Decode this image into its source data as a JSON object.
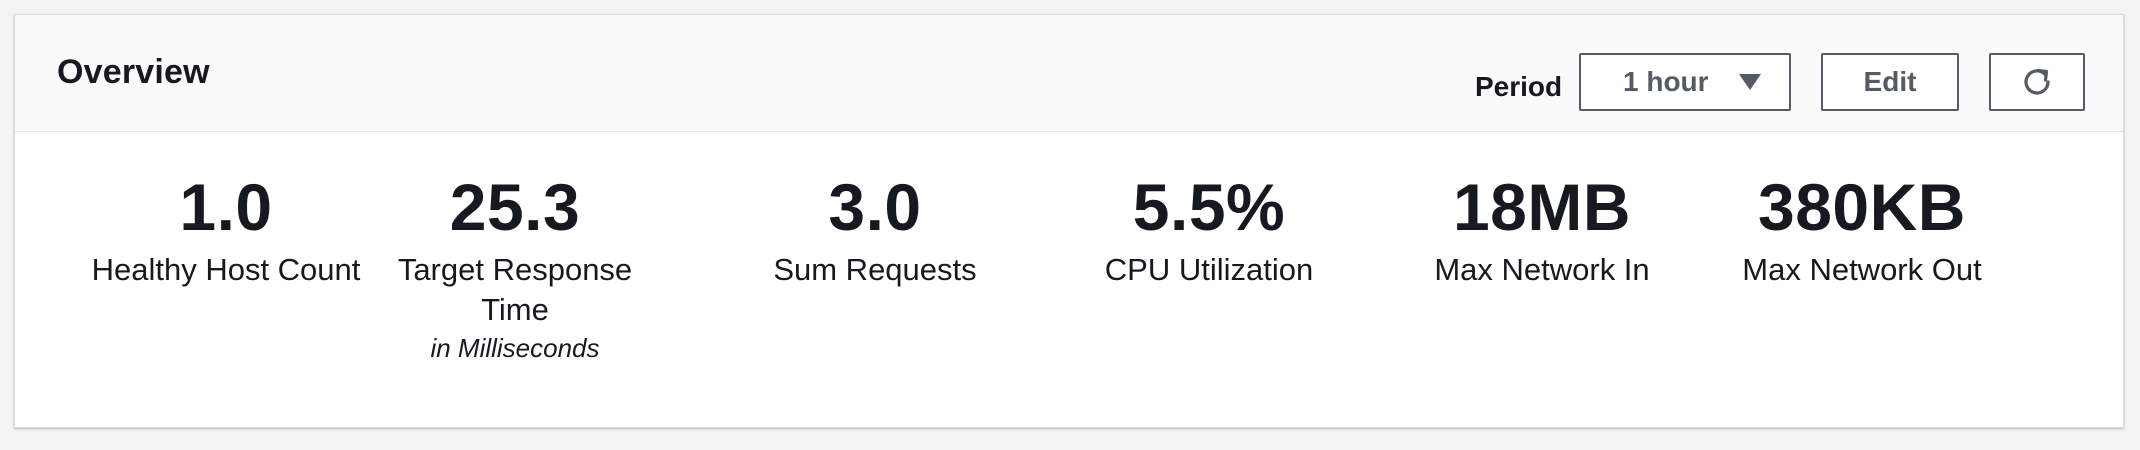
{
  "overview": {
    "title": "Overview",
    "period_label": "Period",
    "period_value": "1 hour",
    "edit_label": "Edit"
  },
  "metrics": [
    {
      "value": "1.0",
      "label": "Healthy Host Count"
    },
    {
      "value": "25.3",
      "label": "Target Response Time",
      "sublabel": "in Milliseconds"
    },
    {
      "value": "3.0",
      "label": "Sum Requests"
    },
    {
      "value": "5.5%",
      "label": "CPU Utilization"
    },
    {
      "value": "18MB",
      "label": "Max Network In"
    },
    {
      "value": "380KB",
      "label": "Max Network Out"
    }
  ],
  "icons": {
    "period_dropdown": "caret-down-icon",
    "refresh": "refresh-icon"
  },
  "colors": {
    "button_border": "#545b64",
    "text": "#16191f",
    "header_bg": "#fafafa"
  }
}
